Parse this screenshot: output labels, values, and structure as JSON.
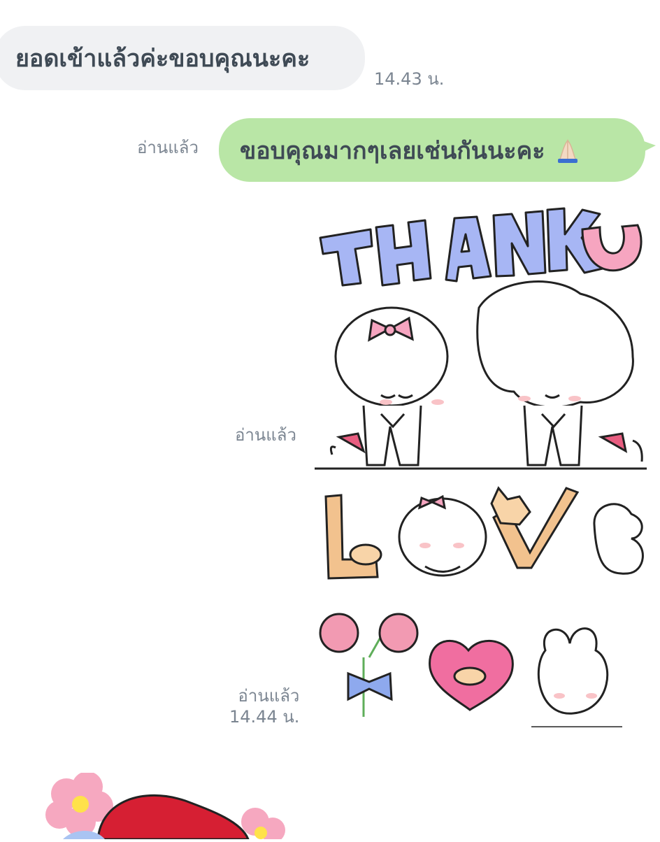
{
  "messages": {
    "incoming_1": {
      "text": "ยอดเข้าแล้วค่ะขอบคุณนะคะ",
      "time": "14.43 น."
    },
    "outgoing_1": {
      "text": "ขอบคุณมากๆเลยเช่นกันนะคะ",
      "emoji": "folded-hands",
      "read": "อ่านแล้ว"
    },
    "sticker_1": {
      "letters": "THANK U",
      "read": "อ่านแล้ว"
    },
    "sticker_2": {
      "letters": "LOVE",
      "time": "14.44 น."
    },
    "sticker_3": {
      "read": "อ่านแล้ว",
      "time": "14.44 น."
    }
  },
  "colors": {
    "incoming_bubble": "#f0f1f3",
    "outgoing_bubble": "#b9e6a6",
    "meta_text": "#7b8591",
    "sticker_blue": "#a7b6f4",
    "sticker_pink": "#f6a5c0",
    "sticker_red": "#d61f33"
  }
}
